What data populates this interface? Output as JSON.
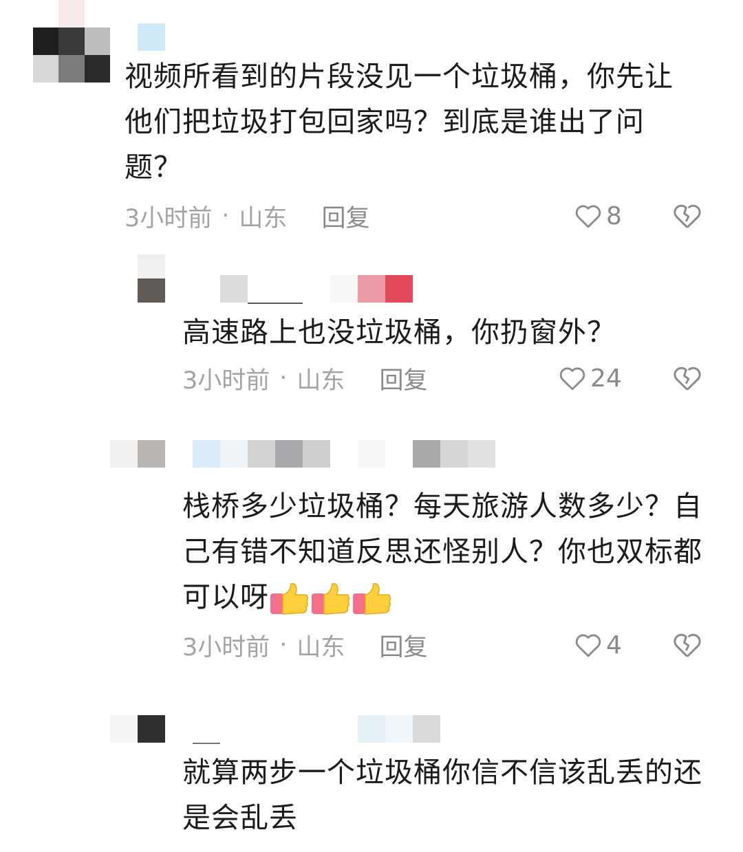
{
  "comments": [
    {
      "text": "视频所看到的片段没见一个垃圾桶，你先让他们把垃圾打包回家吗？到底是谁出了问题？",
      "time": "3小时前",
      "sep": "·",
      "location": "山东",
      "reply_label": "回复",
      "likes": "8",
      "emoji": []
    },
    {
      "text": "高速路上也没垃圾桶，你扔窗外？",
      "time": "3小时前",
      "sep": "·",
      "location": "山东",
      "reply_label": "回复",
      "likes": "24",
      "emoji": []
    },
    {
      "text": "栈桥多少垃圾桶？每天旅游人数多少？自己有错不知道反思还怪别人？你也双标都可以呀",
      "time": "3小时前",
      "sep": "·",
      "location": "山东",
      "reply_label": "回复",
      "likes": "4",
      "emoji": [
        "thumbs-up",
        "thumbs-up",
        "thumbs-up"
      ]
    },
    {
      "text": "就算两步一个垃圾桶你信不信该乱丢的还是会乱丢",
      "emoji": []
    }
  ],
  "colors": {
    "text": "#1b1b1b",
    "meta": "#a3a3a3",
    "icon": "#8a8a8a",
    "background": "#ffffff"
  },
  "icons": [
    "heart-outline-icon",
    "broken-heart-icon",
    "thumbs-up-emoji"
  ]
}
